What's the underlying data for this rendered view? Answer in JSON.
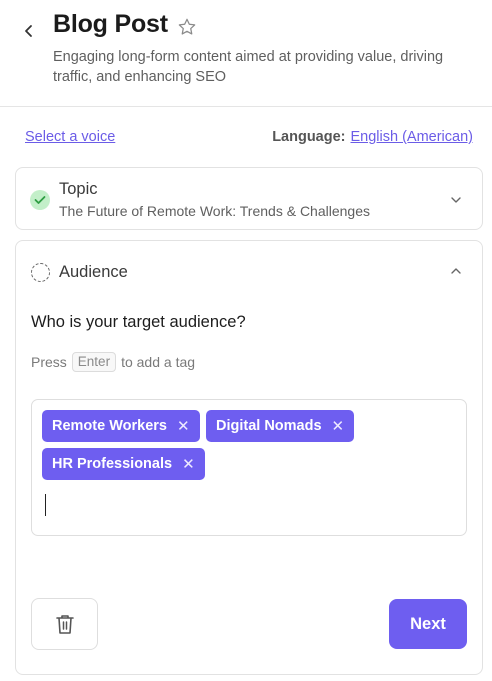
{
  "header": {
    "title": "Blog Post",
    "subtitle": "Engaging long-form content aimed at providing value, driving traffic, and enhancing SEO",
    "back_icon": "chevron-left-icon",
    "star_icon": "star-outline-icon"
  },
  "settings": {
    "voice_link": "Select a voice",
    "language_label": "Language:",
    "language_value": "English (American)"
  },
  "topic": {
    "label": "Topic",
    "value": "The Future of Remote Work: Trends & Challenges",
    "status": "complete",
    "expanded": false
  },
  "audience": {
    "label": "Audience",
    "status": "in-progress",
    "expanded": true,
    "question": "Who is your target audience?",
    "hint_prefix": "Press",
    "hint_key": "Enter",
    "hint_suffix": "to add a tag",
    "tags": [
      {
        "label": "Remote Workers"
      },
      {
        "label": "Digital Nomads"
      },
      {
        "label": "HR Professionals"
      }
    ]
  },
  "actions": {
    "delete_icon": "trash-icon",
    "next_label": "Next"
  },
  "colors": {
    "accent": "#6e5ef0",
    "link": "#6b5ce7",
    "check_bg": "#c3efc9",
    "check_mark": "#2f9e44"
  }
}
